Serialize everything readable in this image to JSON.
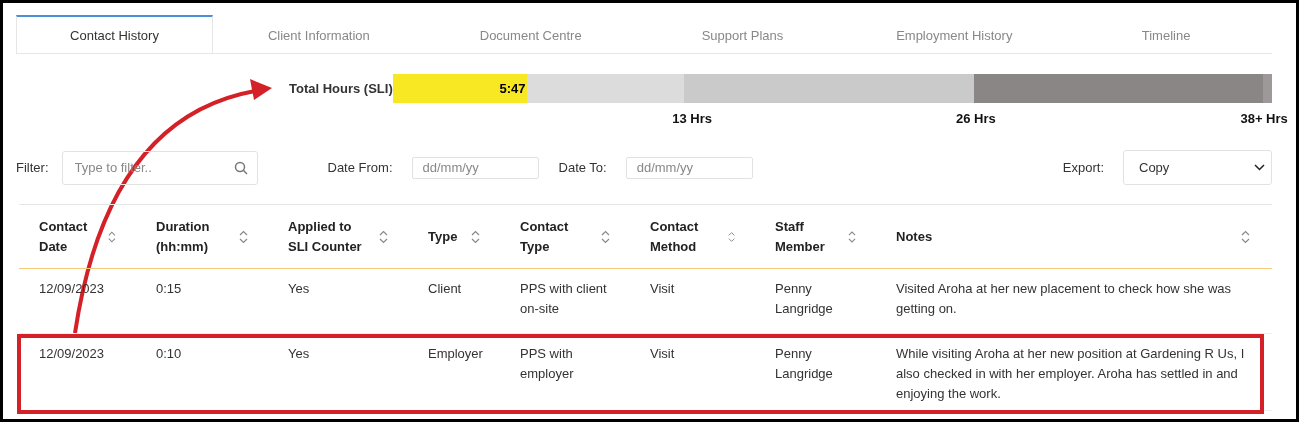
{
  "tabs": [
    {
      "label": "Contact History",
      "selected": true
    },
    {
      "label": "Client Information",
      "selected": false
    },
    {
      "label": "Document Centre",
      "selected": false
    },
    {
      "label": "Support Plans",
      "selected": false
    },
    {
      "label": "Employment History",
      "selected": false
    },
    {
      "label": "Timeline",
      "selected": false
    }
  ],
  "hours": {
    "label": "Total Hours (SLI)",
    "level": 0.152,
    "reading": "5:47",
    "ticks": [
      "13 Hrs",
      "26 Hrs",
      "38+ Hrs"
    ]
  },
  "filter": {
    "label": "Filter:",
    "placeholder": "Type to filter.."
  },
  "date_from": {
    "label": "Date From:",
    "placeholder": "dd/mm/yy"
  },
  "date_to": {
    "label": "Date To:",
    "placeholder": "dd/mm/yy"
  },
  "export": {
    "label": "Export:",
    "value": "Copy"
  },
  "table": {
    "columns": [
      "Contact Date",
      "Duration (hh:mm)",
      "Applied to SLI Counter",
      "Type",
      "Contact Type",
      "Contact Method",
      "Staff Member",
      "Notes"
    ],
    "rows": [
      {
        "highlighted": false,
        "cells": [
          "12/09/2023",
          "0:15",
          "Yes",
          "Client",
          "PPS with client on-site",
          "Visit",
          "Penny Langridge",
          "Visited Aroha at her new placement to check how she was getting on."
        ]
      },
      {
        "highlighted": true,
        "cells": [
          "12/09/2023",
          "0:10",
          "Yes",
          "Employer",
          "PPS with employer",
          "Visit",
          "Penny Langridge",
          "While visiting Aroha at her new position at Gardening R Us, I also checked in with her employer. Aroha has settled in and enjoying the work."
        ]
      }
    ]
  }
}
